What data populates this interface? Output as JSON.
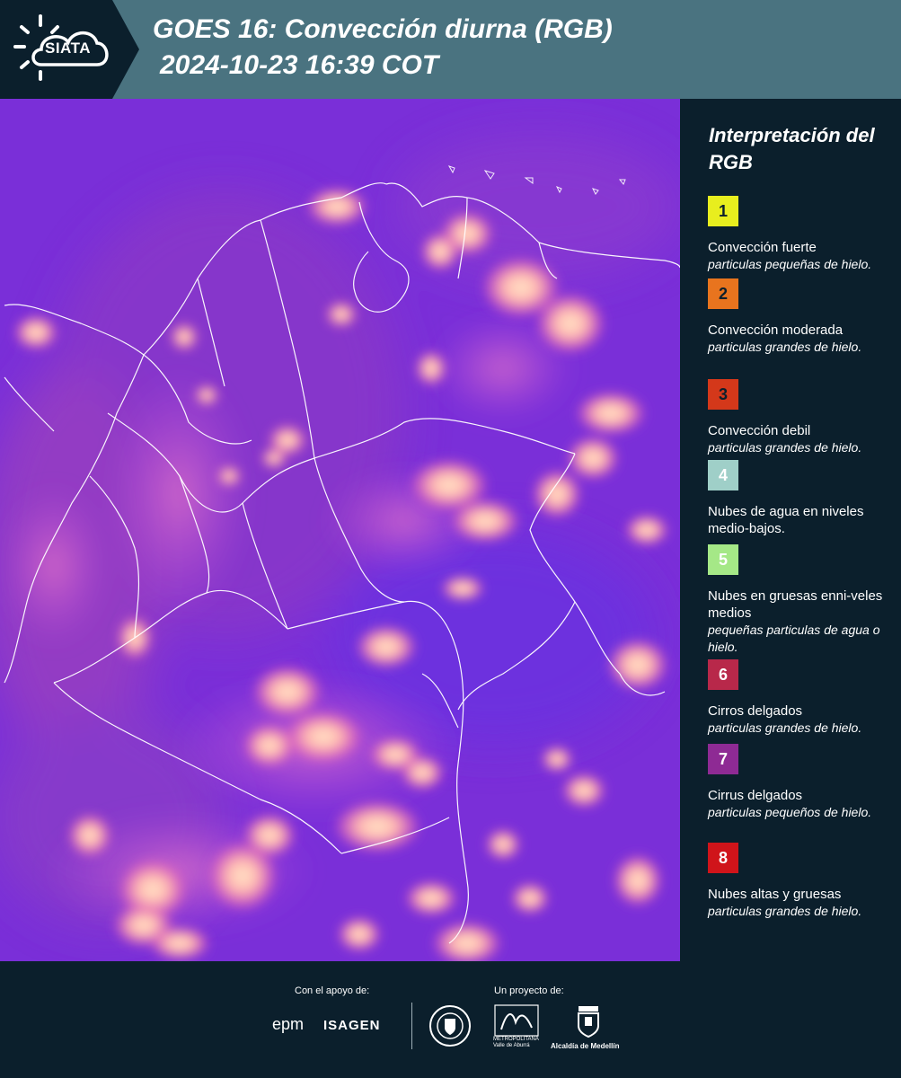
{
  "header": {
    "logo_text": "SIATA",
    "title_line1": "GOES 16: Convección diurna (RGB)",
    "title_line2": "2024-10-23 16:39 COT"
  },
  "map": {
    "base_color": "#7a2fd8",
    "border_color": "#ffffff",
    "icon": "satellite-rgb-map"
  },
  "legend": {
    "title": "Interpretación del RGB",
    "items": [
      {
        "number": "1",
        "color": "#e8ee1e",
        "text_color": "#0b1f2c",
        "label": "Convección fuerte",
        "sub": "particulas pequeñas de hielo."
      },
      {
        "number": "2",
        "color": "#e8741e",
        "text_color": "#0b1f2c",
        "label": "Convección moderada",
        "sub": "particulas grandes de hielo."
      },
      {
        "number": "3",
        "color": "#d4381a",
        "text_color": "#0b1f2c",
        "label": "Convección debil",
        "sub": "particulas grandes de hielo."
      },
      {
        "number": "4",
        "color": "#9fcfc8",
        "text_color": "#ffffff",
        "label": "Nubes de agua en niveles medio-bajos.",
        "sub": ""
      },
      {
        "number": "5",
        "color": "#a5e887",
        "text_color": "#ffffff",
        "label": "Nubes en gruesas enni-veles medios",
        "sub": "pequeñas particulas de agua o hielo."
      },
      {
        "number": "6",
        "color": "#b8284a",
        "text_color": "#ffffff",
        "label": "Cirros delgados",
        "sub": "particulas grandes de hielo."
      },
      {
        "number": "7",
        "color": "#8e2a94",
        "text_color": "#ffffff",
        "label": "Cirrus delgados",
        "sub": "particulas pequeños de hielo."
      },
      {
        "number": "8",
        "color": "#d0141a",
        "text_color": "#ffffff",
        "label": "Nubes altas y gruesas",
        "sub": "particulas grandes de hielo."
      }
    ]
  },
  "footer": {
    "support_label": "Con el apoyo de:",
    "project_label": "Un proyecto de:",
    "epm": "epm",
    "isagen": "ISAGEN",
    "area_text": "METROPOLITANA Valle de Aburrá",
    "medellin": "Alcaldía de Medellín"
  }
}
